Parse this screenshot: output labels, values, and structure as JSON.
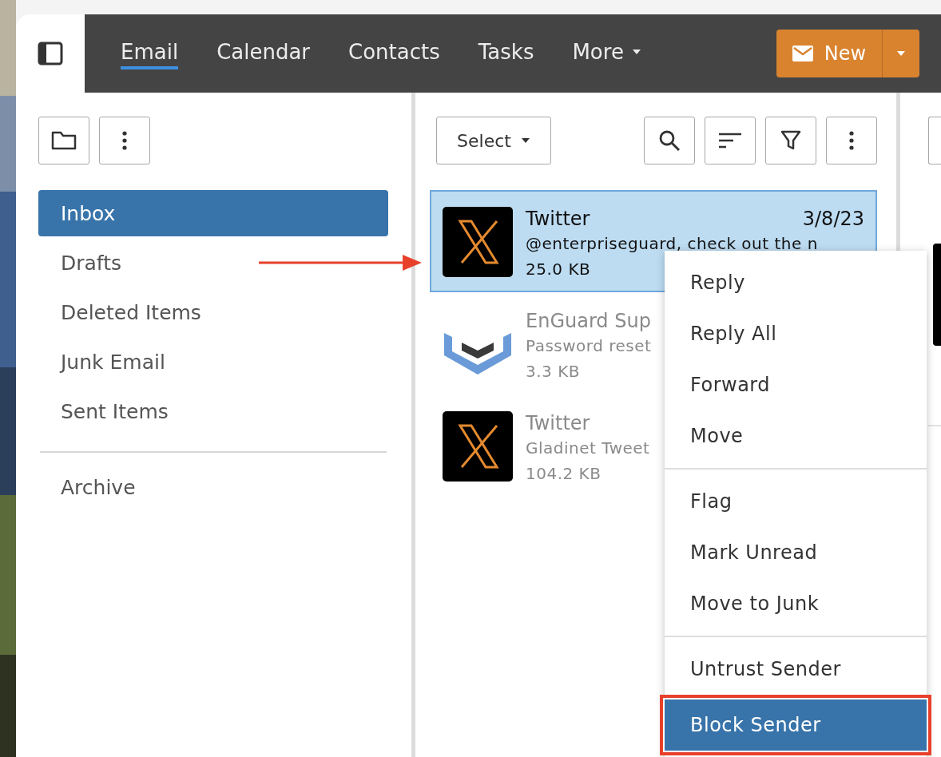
{
  "nav": {
    "tabs": [
      {
        "label": "Email",
        "selected": true,
        "dropdown": false
      },
      {
        "label": "Calendar",
        "selected": false,
        "dropdown": false
      },
      {
        "label": "Contacts",
        "selected": false,
        "dropdown": false
      },
      {
        "label": "Tasks",
        "selected": false,
        "dropdown": false
      },
      {
        "label": "More",
        "selected": false,
        "dropdown": true
      }
    ],
    "new_button": {
      "label": "New"
    }
  },
  "folders": [
    {
      "label": "Inbox",
      "selected": true
    },
    {
      "label": "Drafts",
      "selected": false
    },
    {
      "label": "Deleted Items",
      "selected": false
    },
    {
      "label": "Junk Email",
      "selected": false
    },
    {
      "label": "Sent Items",
      "selected": false
    }
  ],
  "other_folders": [
    {
      "label": "Archive",
      "selected": false
    }
  ],
  "list_toolbar": {
    "select": "Select"
  },
  "messages": [
    {
      "sender": "Twitter",
      "date": "3/8/23",
      "preview": "@enterpriseguard, check out the n",
      "size": "25.0 KB",
      "kind": "x",
      "selected": true,
      "read": false
    },
    {
      "sender": "EnGuard Sup",
      "preview": "Password reset",
      "size": "3.3 KB",
      "kind": "shield",
      "selected": false,
      "read": true
    },
    {
      "sender": "Twitter",
      "preview": "Gladinet Tweet",
      "size": "104.2 KB",
      "kind": "x",
      "selected": false,
      "read": true
    }
  ],
  "context_menu": {
    "groups": [
      {
        "items": [
          {
            "label": "Reply",
            "selected": false
          },
          {
            "label": "Reply All",
            "selected": false
          },
          {
            "label": "Forward",
            "selected": false
          },
          {
            "label": "Move",
            "selected": false
          }
        ]
      },
      {
        "items": [
          {
            "label": "Flag",
            "selected": false
          },
          {
            "label": "Mark Unread",
            "selected": false
          },
          {
            "label": "Move to Junk",
            "selected": false
          }
        ]
      },
      {
        "items": [
          {
            "label": "Untrust Sender",
            "selected": false
          },
          {
            "label": "Block Sender",
            "selected": true
          }
        ]
      }
    ]
  }
}
